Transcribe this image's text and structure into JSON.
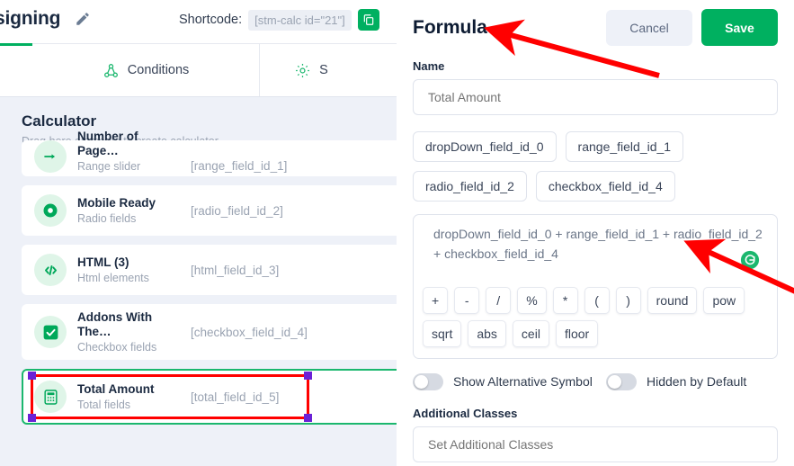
{
  "topbar": {
    "page_title": "signing",
    "pencil_icon": "pencil-icon",
    "shortcode_label": "Shortcode:",
    "shortcode_value": "[stm-calc id=\"21\"]",
    "copy_icon": "copy-icon"
  },
  "tabs": [
    {
      "label": "Conditions",
      "icon": "conditions-icon"
    },
    {
      "label": "S",
      "icon": "gear-icon"
    }
  ],
  "calculator": {
    "title": "Calculator",
    "subtitle": "Drag here elements to create calculator",
    "fields": [
      {
        "name": "Number of Page…",
        "type": "Range slider",
        "id": "[range_field_id_1]",
        "icon": "range-slider-icon",
        "clipped": true,
        "selected": false
      },
      {
        "name": "Mobile Ready",
        "type": "Radio fields",
        "id": "[radio_field_id_2]",
        "icon": "radio-icon",
        "clipped": false,
        "selected": false
      },
      {
        "name": "HTML (3)",
        "type": "Html elements",
        "id": "[html_field_id_3]",
        "icon": "code-icon",
        "clipped": false,
        "selected": false
      },
      {
        "name": "Addons With The…",
        "type": "Checkbox fields",
        "id": "[checkbox_field_id_4]",
        "icon": "checkbox-icon",
        "clipped": false,
        "selected": false
      },
      {
        "name": "Total Amount",
        "type": "Total fields",
        "id": "[total_field_id_5]",
        "icon": "calculator-icon",
        "clipped": false,
        "selected": true
      }
    ]
  },
  "formula_panel": {
    "title": "Formula",
    "cancel_label": "Cancel",
    "save_label": "Save",
    "name_label": "Name",
    "name_value": "Total Amount",
    "name_placeholder": "Total Amount",
    "field_chips": [
      "dropDown_field_id_0",
      "range_field_id_1",
      "radio_field_id_2",
      "checkbox_field_id_4"
    ],
    "expression": "dropDown_field_id_0 + range_field_id_1 + radio_field_id_2 + checkbox_field_id_4",
    "refresh_icon": "refresh-icon",
    "operators": [
      "+",
      "-",
      "/",
      "%",
      "*",
      "(",
      ")",
      "round",
      "pow",
      "sqrt",
      "abs",
      "ceil",
      "floor"
    ],
    "toggles": [
      {
        "label": "Show Alternative Symbol",
        "on": false
      },
      {
        "label": "Hidden by Default",
        "on": false
      }
    ],
    "additional_classes_label": "Additional Classes",
    "additional_classes_placeholder": "Set Additional Classes",
    "additional_classes_value": ""
  },
  "colors": {
    "brand_green": "#00b060",
    "accent_green": "#1bb76e",
    "panel_bg": "#eef1f8",
    "text_dark": "#1b2a41",
    "text_muted": "#9aa3b2",
    "annotation_red": "#ff0000",
    "handle_purple": "#6b21d6"
  }
}
